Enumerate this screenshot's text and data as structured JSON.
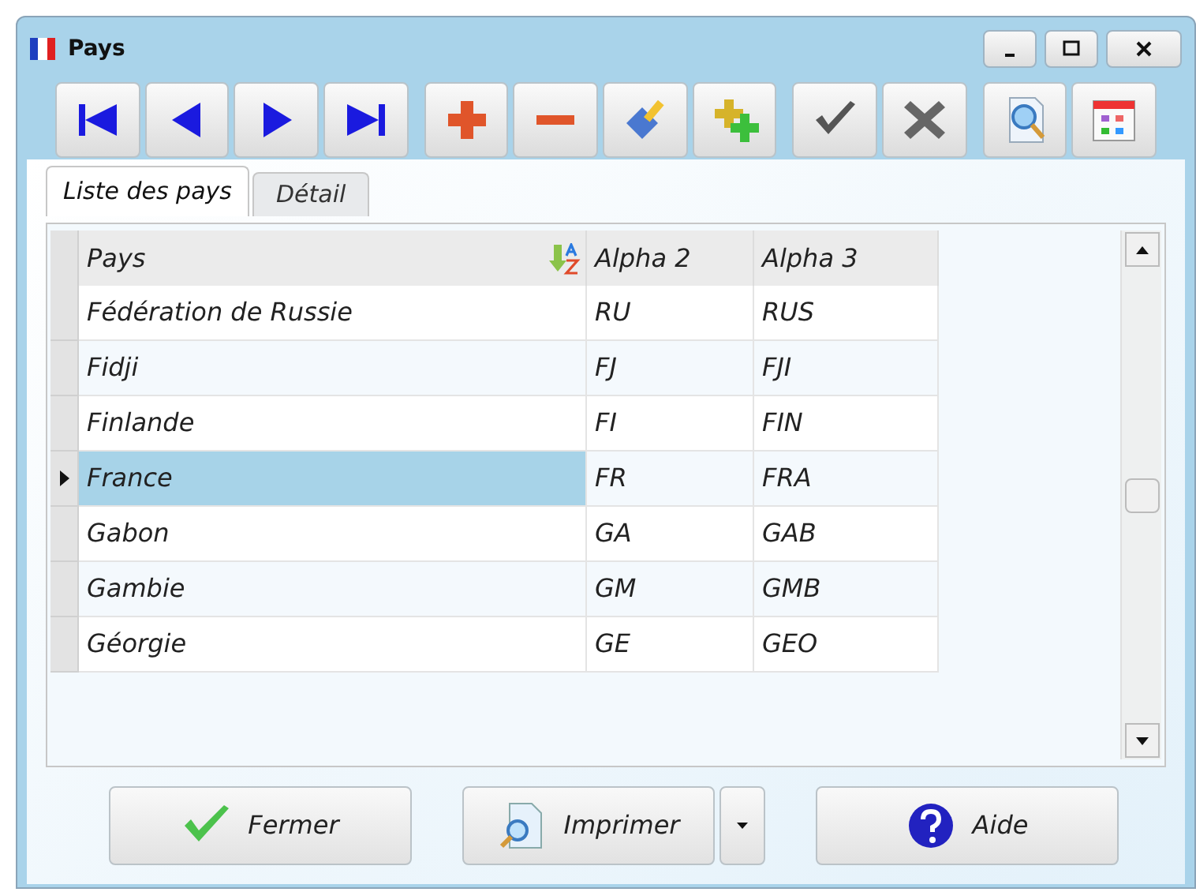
{
  "window": {
    "title": "Pays",
    "controls": [
      {
        "kind": "minimize"
      },
      {
        "kind": "maximize"
      },
      {
        "kind": "close"
      }
    ]
  },
  "toolbar": [
    {
      "kind": "first",
      "separated": false
    },
    {
      "kind": "previous",
      "separated": false
    },
    {
      "kind": "next",
      "separated": false
    },
    {
      "kind": "last",
      "separated": false
    },
    {
      "kind": "add",
      "separated": true
    },
    {
      "kind": "remove",
      "separated": false
    },
    {
      "kind": "edit",
      "separated": false
    },
    {
      "kind": "duplicate",
      "separated": false
    },
    {
      "kind": "validate",
      "separated": true
    },
    {
      "kind": "cancel",
      "separated": false
    },
    {
      "kind": "search",
      "separated": true
    },
    {
      "kind": "calendar",
      "separated": false
    }
  ],
  "tabs": [
    {
      "label": "Liste des pays",
      "selected": true
    },
    {
      "label": "Détail",
      "selected": false
    }
  ],
  "table": {
    "columns": [
      {
        "label": "Pays",
        "sorted": true
      },
      {
        "label": "Alpha 2",
        "sorted": false
      },
      {
        "label": "Alpha 3",
        "sorted": false
      }
    ],
    "rows": [
      {
        "cells": [
          "Fédération de Russie",
          "RU",
          "RUS"
        ],
        "selected": false
      },
      {
        "cells": [
          "Fidji",
          "FJ",
          "FJI"
        ],
        "selected": false
      },
      {
        "cells": [
          "Finlande",
          "FI",
          "FIN"
        ],
        "selected": false
      },
      {
        "cells": [
          "France",
          "FR",
          "FRA"
        ],
        "selected": true
      },
      {
        "cells": [
          "Gabon",
          "GA",
          "GAB"
        ],
        "selected": false
      },
      {
        "cells": [
          "Gambie",
          "GM",
          "GMB"
        ],
        "selected": false
      },
      {
        "cells": [
          "Géorgie",
          "GE",
          "GEO"
        ],
        "selected": false
      }
    ]
  },
  "buttons": [
    {
      "label": "Fermer",
      "kind": "close",
      "dropdown": false
    },
    {
      "label": "Imprimer",
      "kind": "print",
      "dropdown": true
    },
    {
      "label": "Aide",
      "kind": "help",
      "dropdown": false
    }
  ]
}
